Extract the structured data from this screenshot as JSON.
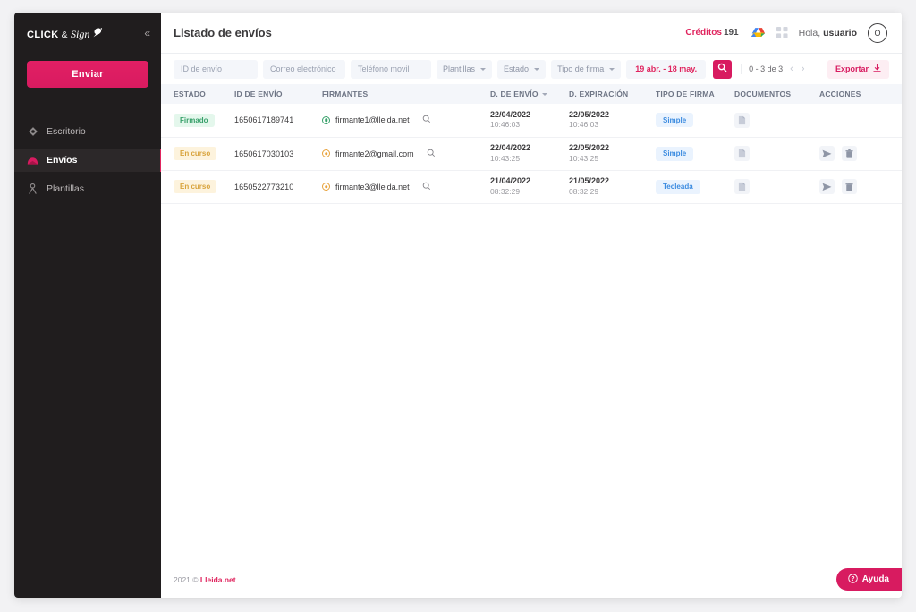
{
  "sidebar": {
    "brand": {
      "click": "CLICK",
      "amp": "&",
      "sign": "Sign"
    },
    "collapse_icon": "«",
    "send_button": "Enviar",
    "items": [
      {
        "label": "Escritorio",
        "icon": "diamond-icon",
        "active": false
      },
      {
        "label": "Envíos",
        "icon": "envelope-icon",
        "active": true
      },
      {
        "label": "Plantillas",
        "icon": "person-icon",
        "active": false
      }
    ]
  },
  "header": {
    "title": "Listado de envíos",
    "credits_label": "Créditos",
    "credits_value": "191",
    "cloud_icon": "cloud-icon",
    "apps_icon": "grid-icon",
    "greeting_prefix": "Hola,",
    "greeting_user": "usuario",
    "avatar_letter": "O"
  },
  "filters": {
    "id_placeholder": "ID de envío",
    "email_placeholder": "Correo electrónico",
    "phone_placeholder": "Teléfono movil",
    "templates_label": "Plantillas",
    "status_label": "Estado",
    "signature_type_label": "Tipo de firma",
    "date_range": "19 abr. - 18 may.",
    "search_icon": "search-icon",
    "pagination_count": "0 - 3 de 3",
    "prev_icon": "‹",
    "next_icon": "›",
    "export_label": "Exportar",
    "export_icon": "download-icon"
  },
  "table": {
    "columns": [
      "ESTADO",
      "ID DE ENVÍO",
      "FIRMANTES",
      "D. DE ENVÍO",
      "D. EXPIRACIÓN",
      "TIPO DE FIRMA",
      "DOCUMENTOS",
      "ACCIONES"
    ],
    "rows": [
      {
        "estado": "Firmado",
        "estado_kind": "firmado",
        "id": "1650617189741",
        "firmante": "firmante1@lleida.net",
        "firmante_state": "green",
        "envio_fecha": "22/04/2022",
        "envio_hora": "10:46:03",
        "exp_fecha": "22/05/2022",
        "exp_hora": "10:46:03",
        "tipo_firma": "Simple",
        "has_actions": false
      },
      {
        "estado": "En curso",
        "estado_kind": "encurso",
        "id": "1650617030103",
        "firmante": "firmante2@gmail.com",
        "firmante_state": "amber",
        "envio_fecha": "22/04/2022",
        "envio_hora": "10:43:25",
        "exp_fecha": "22/05/2022",
        "exp_hora": "10:43:25",
        "tipo_firma": "Simple",
        "has_actions": true
      },
      {
        "estado": "En curso",
        "estado_kind": "encurso",
        "id": "1650522773210",
        "firmante": "firmante3@lleida.net",
        "firmante_state": "amber",
        "envio_fecha": "21/04/2022",
        "envio_hora": "08:32:29",
        "exp_fecha": "21/05/2022",
        "exp_hora": "08:32:29",
        "tipo_firma": "Tecleada",
        "has_actions": true
      }
    ]
  },
  "footer": {
    "copyright_year": "2021 ©",
    "copyright_brand": "Lleida.net",
    "help_label": "Ayuda",
    "help_icon": "question-icon"
  },
  "colors": {
    "accent": "#d81b60",
    "accent_light": "#e0245e",
    "sidebar_bg": "#201d1e",
    "status_green": "#37a06a",
    "status_amber": "#d8a33c",
    "type_blue": "#3d8ce0"
  }
}
